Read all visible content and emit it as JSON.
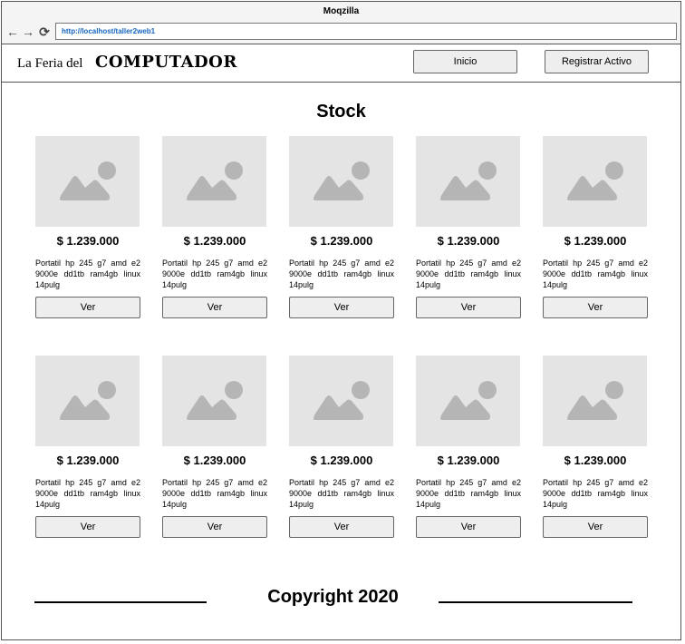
{
  "browser": {
    "title": "Moqzilla",
    "url": "http://localhost/taller2web1",
    "back_icon": "←",
    "forward_icon": "→",
    "reload_icon": "⟳"
  },
  "header": {
    "brand_prefix": "La Feria del",
    "brand_name": "COMPUTADOR",
    "nav": {
      "inicio": "Inicio",
      "registrar": "Registrar Activo"
    }
  },
  "stock": {
    "title": "Stock",
    "products": [
      {
        "price": "$ 1.239.000",
        "description": "Portatil hp 245 g7 amd e2 9000e dd1tb ram4gb linux 14pulg",
        "button": "Ver"
      },
      {
        "price": "$ 1.239.000",
        "description": "Portatil hp 245 g7 amd e2 9000e dd1tb ram4gb linux 14pulg",
        "button": "Ver"
      },
      {
        "price": "$ 1.239.000",
        "description": "Portatil hp 245 g7 amd e2 9000e dd1tb ram4gb linux 14pulg",
        "button": "Ver"
      },
      {
        "price": "$ 1.239.000",
        "description": "Portatil hp 245 g7 amd e2 9000e dd1tb ram4gb linux 14pulg",
        "button": "Ver"
      },
      {
        "price": "$ 1.239.000",
        "description": "Portatil hp 245 g7 amd e2 9000e dd1tb ram4gb linux 14pulg",
        "button": "Ver"
      },
      {
        "price": "$ 1.239.000",
        "description": "Portatil hp 245 g7 amd e2 9000e dd1tb ram4gb linux 14pulg",
        "button": "Ver"
      },
      {
        "price": "$ 1.239.000",
        "description": "Portatil hp 245 g7 amd e2 9000e dd1tb ram4gb linux 14pulg",
        "button": "Ver"
      },
      {
        "price": "$ 1.239.000",
        "description": "Portatil hp 245 g7 amd e2 9000e dd1tb ram4gb linux 14pulg",
        "button": "Ver"
      },
      {
        "price": "$ 1.239.000",
        "description": "Portatil hp 245 g7 amd e2 9000e dd1tb ram4gb linux 14pulg",
        "button": "Ver"
      },
      {
        "price": "$ 1.239.000",
        "description": "Portatil hp 245 g7 amd e2 9000e dd1tb ram4gb linux 14pulg",
        "button": "Ver"
      }
    ]
  },
  "footer": {
    "copyright": "Copyright 2020"
  }
}
